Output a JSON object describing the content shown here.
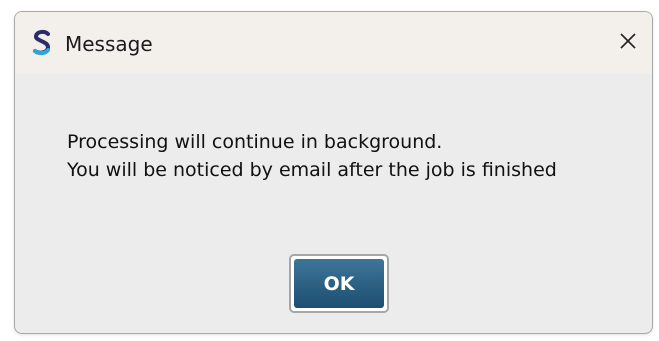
{
  "window": {
    "title": "Message",
    "app_icon": "s-logo-icon",
    "close_icon": "close-icon"
  },
  "message": {
    "lines": [
      "Processing will continue in background.",
      "You will be noticed by email after the job is finished"
    ]
  },
  "buttons": {
    "ok_label": "OK"
  },
  "colors": {
    "ok_button": "#2a5f84",
    "titlebar": "#f3f0ec",
    "body": "#ececec",
    "logo_dark": "#2b2c6b",
    "logo_accent": "#2aa7d8"
  }
}
